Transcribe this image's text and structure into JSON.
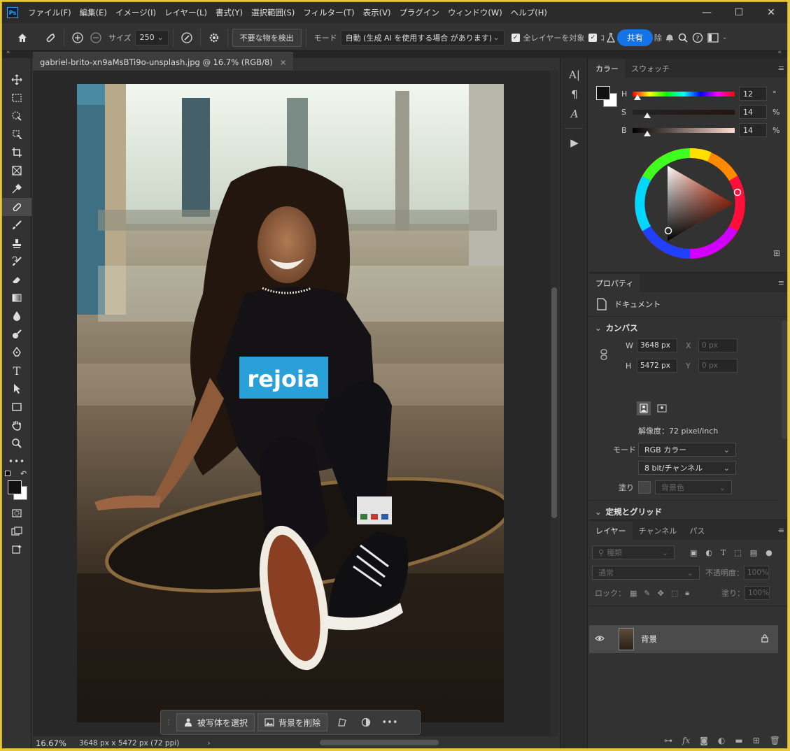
{
  "menubar": {
    "app_icon": "Ps",
    "items": [
      "ファイル(F)",
      "編集(E)",
      "イメージ(I)",
      "レイヤー(L)",
      "書式(Y)",
      "選択範囲(S)",
      "フィルター(T)",
      "表示(V)",
      "プラグイン",
      "ウィンドウ(W)",
      "ヘルプ(H)"
    ],
    "window_controls": [
      "—",
      "☐",
      "✕"
    ]
  },
  "options": {
    "size_label": "サイズ",
    "size_value": "250",
    "detect_button": "不要な物を検出",
    "mode_label": "モード",
    "mode_value": "自動 (生成 AI を使用する場合 があります)",
    "all_layers_label": "全レイヤーを対象",
    "extra_label_1": "ｺ",
    "extra_label_2": "除",
    "share_button": "共有"
  },
  "document": {
    "tab_title": "gabriel-brito-xn9aMsBTi9o-unsplash.jpg @ 16.7% (RGB/8)",
    "close_glyph": "×",
    "zoom": "16.67%",
    "info": "3648 px x 5472 px (72 ppi)",
    "shirt_text": "rejoia"
  },
  "taskbar": {
    "select_subject": "被写体を選択",
    "remove_bg": "背景を削除"
  },
  "color_panel": {
    "tabs": [
      "カラー",
      "スウォッチ"
    ],
    "h_label": "H",
    "h_value": "12",
    "h_unit": "°",
    "s_label": "S",
    "s_value": "14",
    "s_unit": "%",
    "b_label": "B",
    "b_value": "14",
    "b_unit": "%",
    "foreground": "#231f1e",
    "background": "#ffffff"
  },
  "properties": {
    "tab": "プロパティ",
    "doc_label": "ドキュメント",
    "canvas_header": "カンバス",
    "w_label": "W",
    "w_value": "3648 px",
    "h_label": "H",
    "h_value": "5472 px",
    "x_label": "X",
    "x_value": "0 px",
    "y_label": "Y",
    "y_value": "0 px",
    "resolution": "解像度：72 pixel/inch",
    "mode_label": "モード",
    "mode_value": "RGB カラー",
    "depth_value": "8 bit/チャンネル",
    "fill_label": "塗り",
    "fill_value": "背景色",
    "rulers_header": "定規とグリッド"
  },
  "layers": {
    "tabs": [
      "レイヤー",
      "チャンネル",
      "パス"
    ],
    "filter_placeholder": "種類",
    "blend_mode": "通常",
    "opacity_label": "不透明度：",
    "opacity_value": "100%",
    "lock_label": "ロック：",
    "fill_label": "塗り：",
    "fill_value": "100%",
    "layer_name": "背景"
  }
}
